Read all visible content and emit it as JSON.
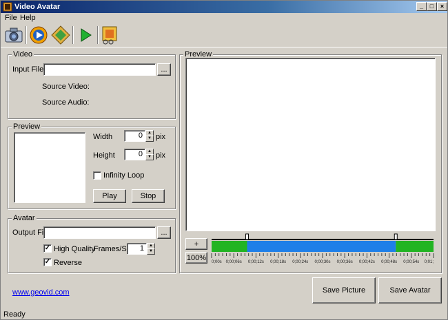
{
  "window": {
    "title": "Video Avatar",
    "minimize": "_",
    "maximize": "□",
    "close": "×"
  },
  "menu": {
    "file": "File",
    "help": "Help"
  },
  "toolbar": {
    "buttons": [
      {
        "name": "camera-icon"
      },
      {
        "name": "media-player-icon"
      },
      {
        "name": "film-diamond-icon"
      },
      {
        "name": "play-icon"
      },
      {
        "name": "filmstrip-scissors-icon"
      }
    ]
  },
  "video_group": {
    "label": "Video",
    "input_file_label": "Input File",
    "input_file_value": "",
    "browse_label": "...",
    "source_video_label": "Source Video:",
    "source_audio_label": "Source Audio:"
  },
  "preview_group": {
    "label": "Preview",
    "width_label": "Width",
    "width_value": "0",
    "height_label": "Height",
    "height_value": "0",
    "unit": "pix",
    "infinity_loop_label": "Infinity Loop",
    "infinity_loop_checked": false,
    "play_label": "Play",
    "stop_label": "Stop"
  },
  "avatar_group": {
    "label": "Avatar",
    "output_file_label": "Output File",
    "output_file_value": "",
    "browse_label": "...",
    "high_quality_label": "High Quality",
    "high_quality_checked": true,
    "reverse_label": "Reverse",
    "reverse_checked": true,
    "fps_label": "Frames/Sec",
    "fps_value": "1"
  },
  "main_preview": {
    "label": "Preview",
    "zoom_in_label": "+",
    "zoom_label": "100%",
    "timeline": {
      "ticks": [
        "0;00s",
        "0;00;06s",
        "0;00;12s",
        "0;00;18s",
        "0;00;24s",
        "0;00;30s",
        "0;00;36s",
        "0;00;42s",
        "0;00;48s",
        "0;00;54s",
        "0;01;"
      ],
      "selection_start_fraction": 0.16,
      "selection_end_fraction": 0.83,
      "colors": {
        "outside": "#22b422",
        "selected": "#1e7fe8"
      }
    }
  },
  "actions": {
    "save_picture": "Save Picture",
    "save_avatar": "Save Avatar"
  },
  "footer": {
    "link": "www.geovid.com"
  },
  "status": {
    "text": "Ready"
  }
}
